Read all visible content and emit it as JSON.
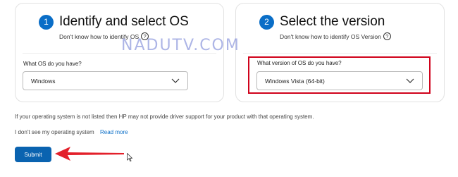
{
  "steps": [
    {
      "number": "1",
      "title": "Identify and select OS",
      "help_text": "Don't know how to identify OS",
      "field_label": "What OS do you have?",
      "selected_value": "Windows"
    },
    {
      "number": "2",
      "title": "Select the version",
      "help_text": "Don't know how to identify OS Version",
      "field_label": "What version of OS do you have?",
      "selected_value": "Windows Vista (64-bit)"
    }
  ],
  "help_icon_glyph": "?",
  "watermark": "NADUTV.COM",
  "note": "If your operating system is not listed then HP may not provide driver support for your product with that operating system.",
  "dont_see_text": "I don't see my operating system",
  "read_more_link": "Read more",
  "submit_label": "Submit",
  "colors": {
    "accent": "#0a6ec7",
    "submit_bg": "#0a63b0",
    "highlight": "#d0021b",
    "arrow": "#e3202a"
  },
  "icons": [
    "help-circle-icon",
    "chevron-down-icon",
    "red-arrow-annotation",
    "mouse-cursor-icon"
  ]
}
